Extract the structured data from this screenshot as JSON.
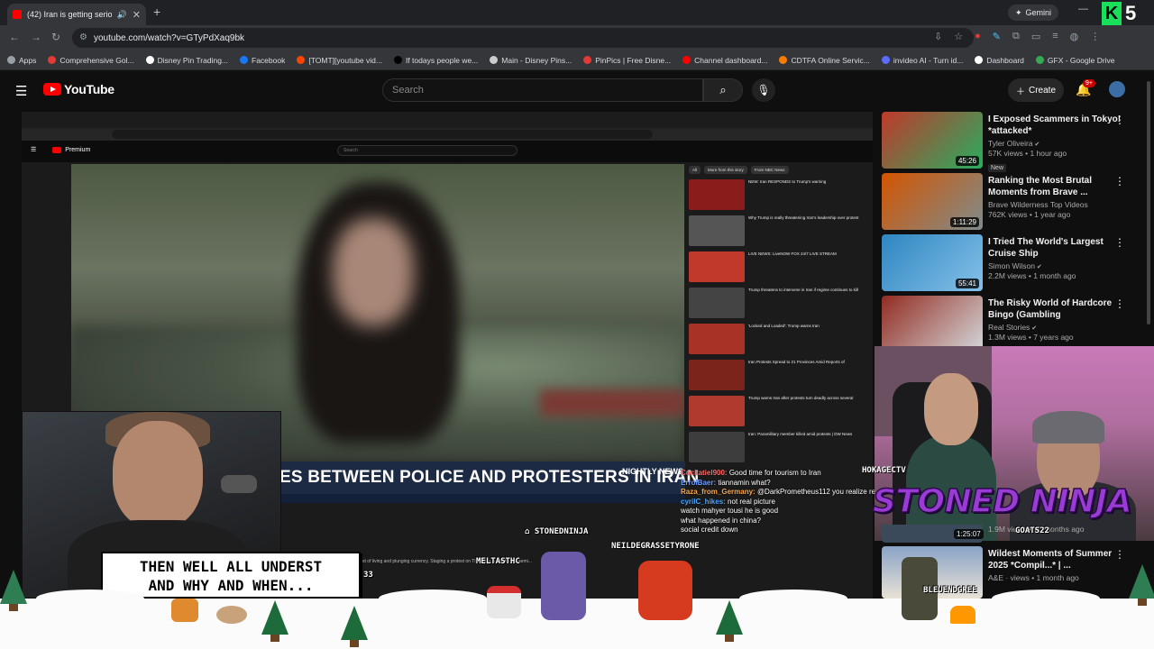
{
  "browser": {
    "tab_title": "(42) Iran is getting serious...",
    "gemini_label": "Gemini",
    "url": "youtube.com/watch?v=GTyPdXaq9bk",
    "bookmarks": [
      {
        "label": "Apps",
        "color": "#9aa0a6"
      },
      {
        "label": "Comprehensive Gol...",
        "color": "#e53935"
      },
      {
        "label": "Disney Pin Trading...",
        "color": "#ffffff"
      },
      {
        "label": "Facebook",
        "color": "#1877f2"
      },
      {
        "label": "[TOMT][youtube vid...",
        "color": "#ff4500"
      },
      {
        "label": "If todays people we...",
        "color": "#000000"
      },
      {
        "label": "Main - Disney Pins...",
        "color": "#cccccc"
      },
      {
        "label": "PinPics | Free Disne...",
        "color": "#e53935"
      },
      {
        "label": "Channel dashboard...",
        "color": "#ff0000"
      },
      {
        "label": "CDTFA Online Servic...",
        "color": "#f57c00"
      },
      {
        "label": "invideo AI - Turn id...",
        "color": "#5b6cff"
      },
      {
        "label": "Dashboard",
        "color": "#ffffff"
      },
      {
        "label": "GFX - Google Drive",
        "color": "#34a853"
      }
    ],
    "k_badge": "K",
    "k_number": "5"
  },
  "youtube": {
    "logo_text": "YouTube",
    "search_placeholder": "Search",
    "create_label": "Create",
    "notif_badge": "9+"
  },
  "video": {
    "lower_third": "ES BETWEEN POLICE AND PROTESTERS IN IRAN",
    "network_logo": "NIGHTLY NEWS",
    "inner_brand": "Premium",
    "inner_search": "Search",
    "rec_chips": [
      "All",
      "More from this story",
      "From NBC News"
    ],
    "inner_recs": [
      "NEW: Iran RESPONDS to Trump's warning",
      "Why Trump is really threatening Iran's leadership over protest",
      "LIVE NEWS: LiveNOW FOX 24/7 LIVE STREAM",
      "Trump threatens to intervene in Iran if regime continues to kill",
      "'Locked and Loaded': Trump warns Iran",
      "Iran Protests Spread to 21 Provinces Amid Reports of",
      "Trump warns Iran after protests turn deadly across several",
      "Iran: Paramilitary member killed amid protests | DW News"
    ],
    "ticker": "...economy, which is plagued by high cost of living and plunging currency. Staging a protest on Thursday, according to semi..."
  },
  "chat": [
    {
      "user": "Cockatiel900:",
      "msg": "Good time for tourism to Iran",
      "color": "#ff6b6b"
    },
    {
      "user": "ErrolBaer:",
      "msg": "tiannamin what?",
      "color": "#6b9bff"
    },
    {
      "user": "Raza_from_Germany:",
      "msg": "@DarkPrometheus112 you realize resources like oil are capped, right?",
      "color": "#ffa64d"
    },
    {
      "user": "cyrilC_hikes:",
      "msg": "not real picture",
      "color": "#4da6ff"
    },
    {
      "user": "",
      "msg": "watch mahyer tousi he is good",
      "color": "#ffffff"
    },
    {
      "user": "",
      "msg": "what happened in china?",
      "color": "#ffffff"
    },
    {
      "user": "",
      "msg": "social credit down",
      "color": "#ffffff"
    }
  ],
  "caption": {
    "line1": "THEN WELL ALL UNDERST",
    "line2": "AND WHY AND WHEN..."
  },
  "overlays": {
    "stoned_ninja": "STONED NINJA",
    "hokagectv": "HOKAGECTV",
    "stoned_label": "STONEDNINJA",
    "neil_label": "NEILDEGRASSETYRONE",
    "melta_label": "MELTASTHC",
    "goats_label": "GOATS22",
    "bleu_label": "BLEUENDGREE",
    "counter": "33"
  },
  "sidebar": [
    {
      "title": "I Exposed Scammers in Tokyo! *attacked*",
      "channel": "Tyler Oliveira",
      "verified": true,
      "stats": "57K views • 1 hour ago",
      "badge": "New",
      "duration": "45:26",
      "thumb_a": "#c0392b",
      "thumb_b": "#27ae60"
    },
    {
      "title": "Ranking the Most Brutal Moments from Brave ...",
      "channel": "Brave Wilderness Top Videos",
      "verified": false,
      "stats": "762K views • 1 year ago",
      "badge": "",
      "duration": "1:11:29",
      "thumb_a": "#d35400",
      "thumb_b": "#7f8c8d"
    },
    {
      "title": "I Tried The World's Largest Cruise Ship",
      "channel": "Simon Wilson",
      "verified": true,
      "stats": "2.2M views • 1 month ago",
      "badge": "",
      "duration": "55:41",
      "thumb_a": "#2e86c1",
      "thumb_b": "#85c1e9"
    },
    {
      "title": "The Risky World of Hardcore Bingo (Gambling Documentary...",
      "channel": "Real Stories",
      "verified": true,
      "stats": "1.3M views • 7 years ago",
      "badge": "",
      "duration": "",
      "thumb_a": "#922b21",
      "thumb_b": "#d5d8dc"
    }
  ],
  "lower_recs": {
    "r2_stats": "1.9M views • 10 months ago",
    "r2_duration": "1:25:07",
    "r3_title": "Wildest Moments of Summer 2025 *Compil...* | ...",
    "r3_channel": "A&E",
    "r3_extra": "views • 1 month ago"
  }
}
